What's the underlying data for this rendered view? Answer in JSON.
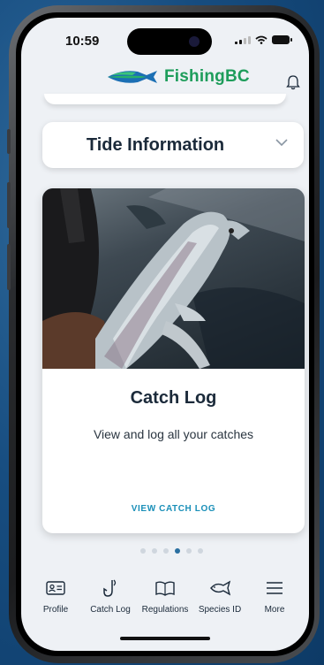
{
  "status_bar": {
    "time": "10:59"
  },
  "header": {
    "logo_text": "FishingBC",
    "icons": [
      "fish-logo-icon",
      "bell-icon"
    ]
  },
  "tide_card": {
    "title": "Tide Information",
    "icon": "chevron-down-icon"
  },
  "catch_card": {
    "title": "Catch Log",
    "description": "View and log all your catches",
    "link": "VIEW CATCH LOG"
  },
  "carousel": {
    "page_count": 6,
    "active_index": 3
  },
  "tabbar": {
    "items": [
      {
        "label": "Profile",
        "icon": "id-card-icon"
      },
      {
        "label": "Catch Log",
        "icon": "hook-icon"
      },
      {
        "label": "Regulations",
        "icon": "book-icon"
      },
      {
        "label": "Species ID",
        "icon": "fish-outline-icon"
      },
      {
        "label": "More",
        "icon": "menu-icon"
      }
    ]
  },
  "colors": {
    "brand_green": "#1e9d5b",
    "brand_blue": "#1b6fb4",
    "link": "#1a8fb8",
    "text_dark": "#1b2a3a"
  }
}
